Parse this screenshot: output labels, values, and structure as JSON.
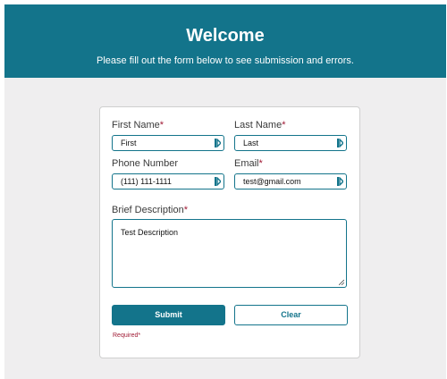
{
  "header": {
    "title": "Welcome",
    "subtitle": "Please fill out the form below to see submission and errors."
  },
  "form": {
    "first_name": {
      "label": "First Name",
      "required_mark": "*",
      "value": "First"
    },
    "last_name": {
      "label": "Last Name",
      "required_mark": "*",
      "value": "Last"
    },
    "phone": {
      "label": "Phone Number",
      "value": "(111) 111-1111"
    },
    "email": {
      "label": "Email",
      "required_mark": "*",
      "value": "test@gmail.com"
    },
    "description": {
      "label": "Brief Description",
      "required_mark": "*",
      "value": "Test Description"
    },
    "submit_label": "Submit",
    "clear_label": "Clear",
    "required_note": "Required*"
  },
  "colors": {
    "accent": "#13748b",
    "required": "#a01b35",
    "page_bg": "#efeeef"
  },
  "icons": {
    "field_icon": "keyboard-autofill-icon",
    "resize_icon": "resize-handle-icon"
  }
}
